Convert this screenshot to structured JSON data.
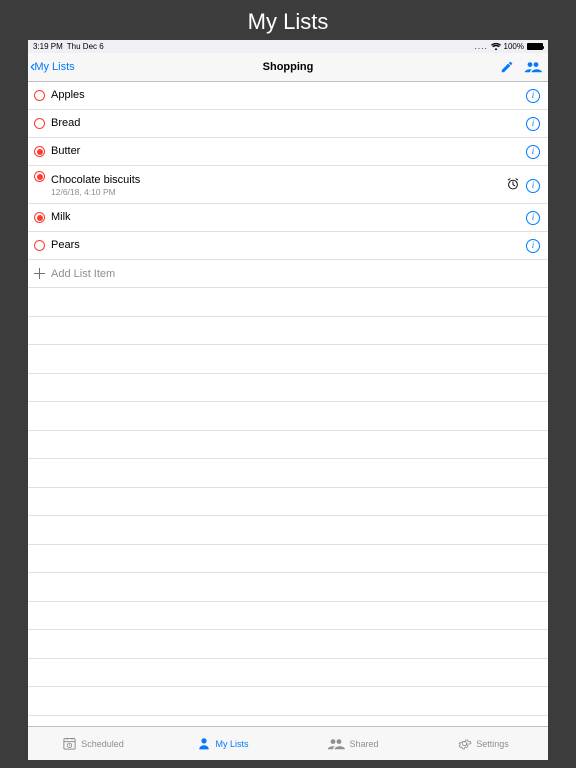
{
  "outer_title": "My Lists",
  "status": {
    "time": "3:19 PM",
    "date": "Thu Dec 6",
    "battery": "100%"
  },
  "nav": {
    "back_label": "My Lists",
    "title": "Shopping"
  },
  "items": [
    {
      "label": "Apples",
      "filled": false
    },
    {
      "label": "Bread",
      "filled": false
    },
    {
      "label": "Butter",
      "filled": true
    },
    {
      "label": "Chocolate biscuits",
      "filled": true,
      "sub": "12/6/18, 4:10 PM",
      "alarm": true
    },
    {
      "label": "Milk",
      "filled": true
    },
    {
      "label": "Pears",
      "filled": false
    }
  ],
  "add_placeholder": "Add List Item",
  "tabs": {
    "scheduled": "Scheduled",
    "mylists": "My Lists",
    "shared": "Shared",
    "settings": "Settings"
  }
}
